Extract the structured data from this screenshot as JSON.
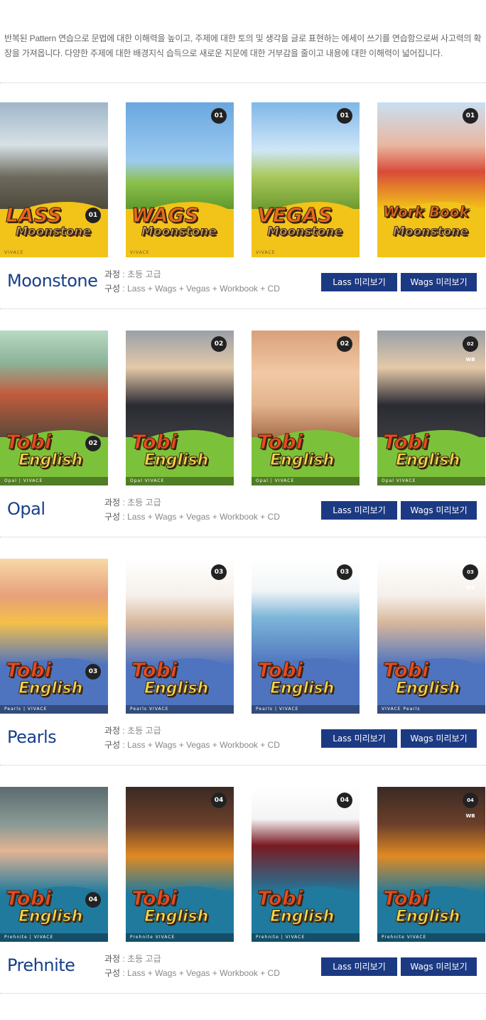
{
  "intro": "반복된 Pattern 연습으로 문법에 대한 이해력을 높이고, 주제에 대한 토의 및 생각을 글로 표현하는 에세이 쓰기를 연습함으로써 사고력의 확장을 가져옵니다. 다양한 주제에 대한 배경지식 습득으로 새로운 지문에 대한 거부감을 줄이고 내용에 대한 이해력이 넓어집니다.",
  "series": [
    {
      "name": "Moonstone",
      "course_label": "과정",
      "course_value": "초등 고급",
      "compose_label": "구성",
      "compose_value": "Lass + Wags + Vegas + Workbook + CD",
      "lass_button": "Lass 미리보기",
      "wags_button": "Wags 미리보기",
      "covers": [
        {
          "title1": "LASS",
          "title2": "Moonstone",
          "level": "01",
          "footer": "VIVACE",
          "bg": "#f2c318",
          "photo": "cyclist-mountain"
        },
        {
          "title1": "WAGS",
          "title2": "Moonstone",
          "level": "01",
          "footer": "VIVACE",
          "bg": "#f2c318",
          "photo": "jumping-family"
        },
        {
          "title1": "VEGAS",
          "title2": "Moonstone",
          "level": "01",
          "footer": "VIVACE",
          "bg": "#f2c318",
          "photo": "apple-on-books"
        },
        {
          "title1": "Work Book",
          "title2": "Moonstone",
          "level": "01",
          "footer": "",
          "bg": "#f2c318",
          "photo": "kids-circle-hands"
        }
      ]
    },
    {
      "name": "Opal",
      "course_label": "과정",
      "course_value": "초등 고급",
      "compose_label": "구성",
      "compose_value": "Lass + Wags + Vegas + Workbook + CD",
      "lass_button": "Lass 미리보기",
      "wags_button": "Wags 미리보기",
      "covers": [
        {
          "title1": "Tobi",
          "title2": "English",
          "level": "02",
          "footer": "Opal | VIVACE",
          "bg": "#7cc13a",
          "photo": "classroom-hands-up"
        },
        {
          "title1": "Tobi",
          "title2": "English",
          "level": "02",
          "footer": "Opal VIVACE",
          "bg": "#7cc13a",
          "photo": "students-reading"
        },
        {
          "title1": "Tobi",
          "title2": "English",
          "level": "02",
          "footer": "Opal | VIVACE",
          "bg": "#7cc13a",
          "photo": "teens-headphones"
        },
        {
          "title1": "Tobi",
          "title2": "English",
          "level": "02 WB",
          "footer": "Opal VIVACE",
          "bg": "#7cc13a",
          "photo": "students-reading"
        }
      ]
    },
    {
      "name": "Pearls",
      "course_label": "과정",
      "course_value": "초등 고급",
      "compose_label": "구성",
      "compose_value": "Lass + Wags + Vegas + Workbook + CD",
      "lass_button": "Lass 미리보기",
      "wags_button": "Wags 미리보기",
      "covers": [
        {
          "title1": "Tobi",
          "title2": "English",
          "level": "03",
          "footer": "Pearls | VIVACE",
          "bg": "#4f74bf",
          "photo": "kids-circle"
        },
        {
          "title1": "Tobi",
          "title2": "English",
          "level": "03",
          "footer": "Pearls VIVACE",
          "bg": "#4f74bf",
          "photo": "girl-with-dog"
        },
        {
          "title1": "Tobi",
          "title2": "English",
          "level": "03",
          "footer": "Pearls | VIVACE",
          "bg": "#4f74bf",
          "photo": "marbles"
        },
        {
          "title1": "Tobi",
          "title2": "English",
          "level": "03 WB",
          "footer": "VIVACE Pearls",
          "bg": "#4f74bf",
          "photo": "girl-with-dog"
        }
      ]
    },
    {
      "name": "Prehnite",
      "course_label": "과정",
      "course_value": "초등 고급",
      "compose_label": "구성",
      "compose_value": "Lass + Wags + Vegas + Workbook + CD",
      "lass_button": "Lass 미리보기",
      "wags_button": "Wags 미리보기",
      "covers": [
        {
          "title1": "Tobi",
          "title2": "English",
          "level": "04",
          "footer": "Prehnite | VIVACE",
          "bg": "#1f7a9e",
          "photo": "kids-chalkboard"
        },
        {
          "title1": "Tobi",
          "title2": "English",
          "level": "04",
          "footer": "Prehnite VIVACE",
          "bg": "#1f7a9e",
          "photo": "witch-girls-pumpkins"
        },
        {
          "title1": "Tobi",
          "title2": "English",
          "level": "04",
          "footer": "Prehnite | VIVACE",
          "bg": "#1f7a9e",
          "photo": "magician"
        },
        {
          "title1": "Tobi",
          "title2": "English",
          "level": "04 WB",
          "footer": "Prehnite VIVACE",
          "bg": "#1f7a9e",
          "photo": "witch-girls-pumpkins"
        }
      ]
    }
  ]
}
